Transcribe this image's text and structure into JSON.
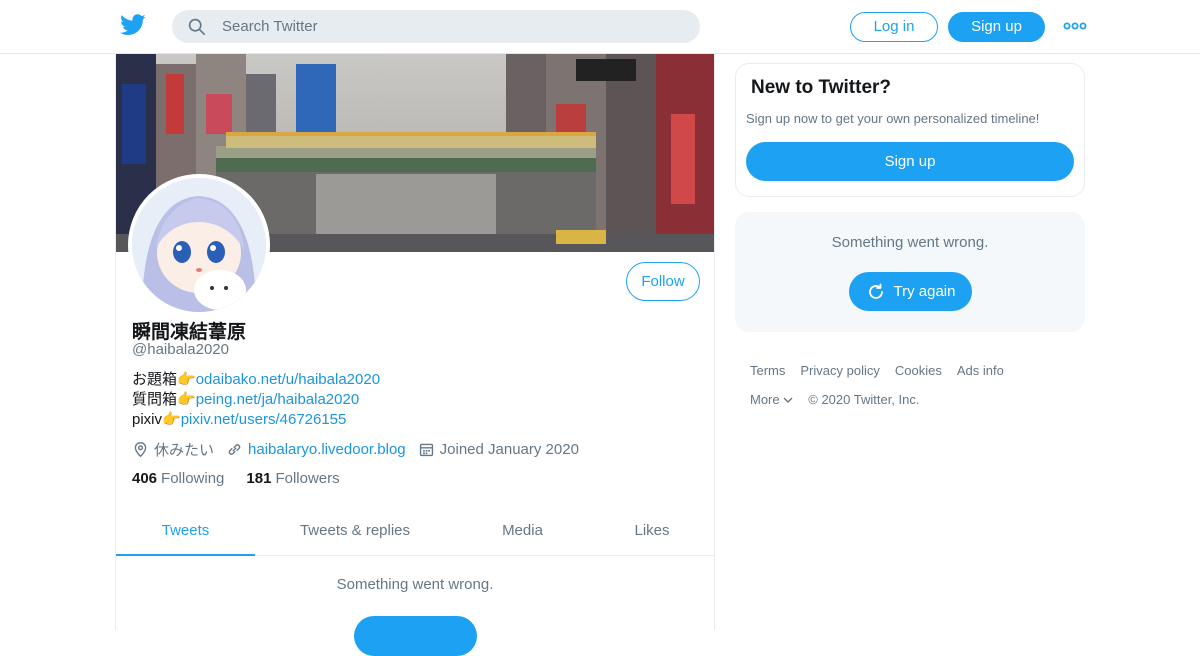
{
  "topbar": {
    "search_placeholder": "Search Twitter",
    "login_label": "Log in",
    "signup_label": "Sign up",
    "more_icon": "more-dots-icon"
  },
  "profile": {
    "display_name": "瞬間凍結葦原",
    "handle": "@haibala2020",
    "follow_label": "Follow",
    "bio": [
      {
        "prefix": "お題箱",
        "emoji": "👉",
        "link": "odaibako.net/u/haibala2020"
      },
      {
        "prefix": "質問箱",
        "emoji": "👉",
        "link": "peing.net/ja/haibala2020"
      },
      {
        "prefix": "pixiv",
        "emoji": "👉",
        "link": "pixiv.net/users/46726155"
      }
    ],
    "location": "休みたい",
    "website": "haibalaryo.livedoor.blog",
    "joined": "Joined January 2020",
    "following_count": "406",
    "following_label": "Following",
    "followers_count": "181",
    "followers_label": "Followers",
    "tabs": [
      {
        "label": "Tweets",
        "active": true
      },
      {
        "label": "Tweets & replies",
        "active": false
      },
      {
        "label": "Media",
        "active": false
      },
      {
        "label": "Likes",
        "active": false
      }
    ],
    "error_text": "Something went wrong."
  },
  "sidebar": {
    "new_title": "New to Twitter?",
    "new_desc": "Sign up now to get your own personalized timeline!",
    "signup_label": "Sign up",
    "error_text": "Something went wrong.",
    "try_again_label": "Try again",
    "footer": {
      "terms": "Terms",
      "privacy": "Privacy policy",
      "cookies": "Cookies",
      "ads": "Ads info",
      "more": "More",
      "copyright": "© 2020 Twitter, Inc."
    }
  },
  "colors": {
    "accent": "#1da1f2",
    "secondary_text": "#657786",
    "link": "#1b95e0"
  }
}
